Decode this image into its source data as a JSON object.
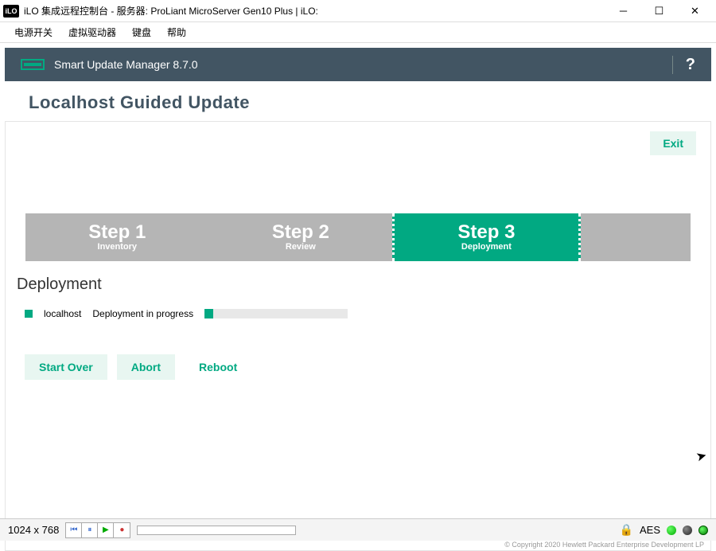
{
  "window": {
    "icon_label": "iLO",
    "title": "iLO 集成远程控制台 - 服务器: ProLiant MicroServer Gen10 Plus | iLO:"
  },
  "menu": {
    "power": "电源开关",
    "vdrive": "虚拟驱动器",
    "keyboard": "键盘",
    "help": "帮助"
  },
  "sum": {
    "title": "Smart Update Manager 8.7.0",
    "help": "?"
  },
  "page": {
    "heading": "Localhost Guided Update",
    "exit": "Exit"
  },
  "steps": {
    "s1_title": "Step 1",
    "s1_sub": "Inventory",
    "s2_title": "Step 2",
    "s2_sub": "Review",
    "s3_title": "Step 3",
    "s3_sub": "Deployment"
  },
  "deploy": {
    "section": "Deployment",
    "host": "localhost",
    "status": "Deployment in progress"
  },
  "actions": {
    "startover": "Start Over",
    "abort": "Abort",
    "reboot": "Reboot"
  },
  "footer": {
    "copyright": "© Copyright 2020 Hewlett Packard Enterprise Development LP"
  },
  "statusbar": {
    "resolution": "1024 x 768",
    "aes": "AES"
  }
}
